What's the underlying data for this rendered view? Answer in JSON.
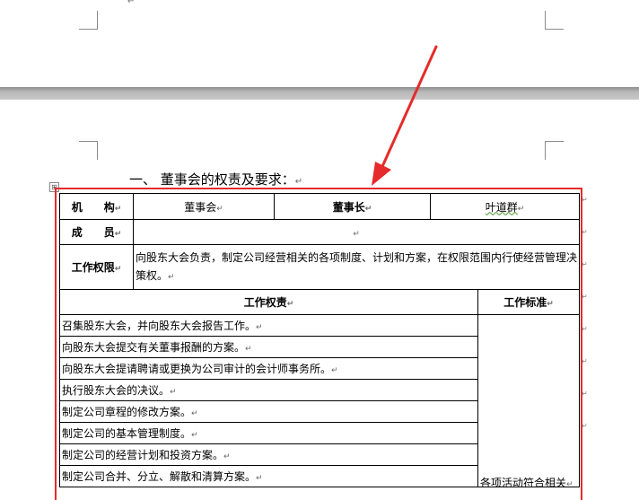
{
  "doc": {
    "paragraph_mark": "↵",
    "heading": "一、 董事会的权责及要求：",
    "anchor_glyph": "⊞"
  },
  "table": {
    "row1": {
      "label": "机　　构",
      "value1": "董事会",
      "label2": "董事长",
      "value2": "叶道群"
    },
    "row2": {
      "label": "成　　员",
      "value": ""
    },
    "row3": {
      "label": "工作权限",
      "value": "向股东大会负责，制定公司经营相关的各项制度、计划和方案，在权限范围内行使经营管理决策权。"
    },
    "header": {
      "duties": "工作权责",
      "standard": "工作标准"
    },
    "duties": [
      "召集股东大会，并向股东大会报告工作。",
      "向股东大会提交有关董事报酬的方案。",
      "向股东大会提请聘请或更换为公司审计的会计师事务所。",
      "执行股东大会的决议。",
      "制定公司章程的修改方案。",
      "制定公司的基本管理制度。",
      "制定公司的经营计划和投资方案。",
      "制定公司合并、分立、解散和清算方案。"
    ],
    "standard_text": "各项活动符合相关"
  },
  "colors": {
    "highlight": "#e52b2b",
    "page_gap": "#a8a8a8"
  }
}
